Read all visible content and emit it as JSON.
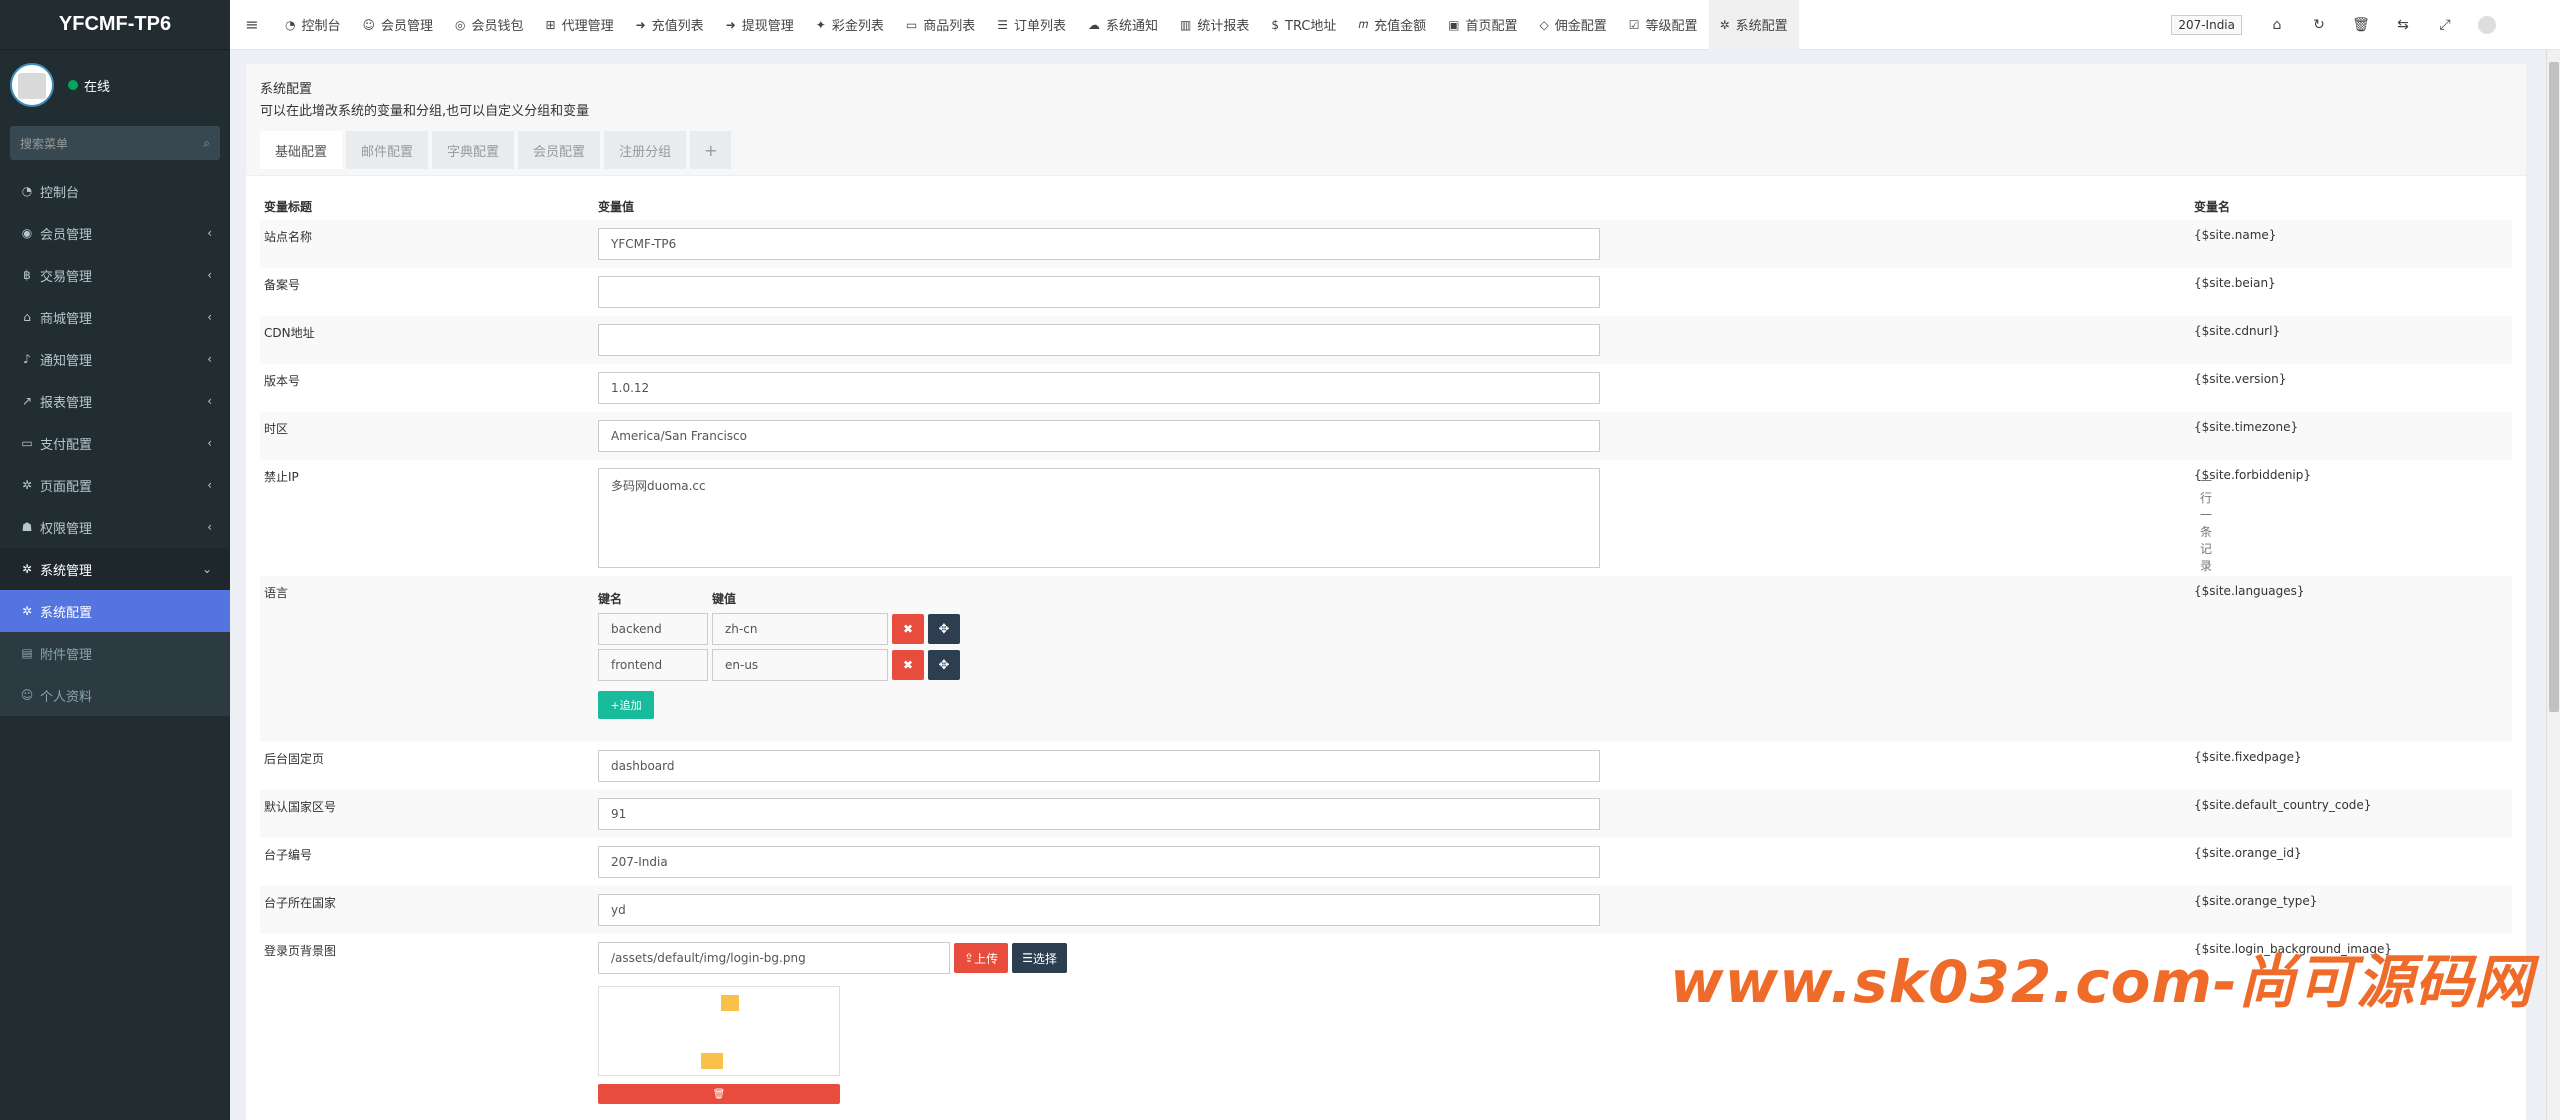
{
  "app": {
    "title": "YFCMF-TP6"
  },
  "user": {
    "status": "在线"
  },
  "search": {
    "placeholder": "搜索菜单"
  },
  "sidebar": {
    "items": [
      {
        "icon": "dashboard-icon",
        "label": "控制台"
      },
      {
        "icon": "user-icon",
        "label": "会员管理"
      },
      {
        "icon": "bitcoin-icon",
        "label": "交易管理"
      },
      {
        "icon": "home-icon",
        "label": "商城管理"
      },
      {
        "icon": "bell-icon",
        "label": "通知管理"
      },
      {
        "icon": "chart-icon",
        "label": "报表管理"
      },
      {
        "icon": "card-icon",
        "label": "支付配置"
      },
      {
        "icon": "gear-icon",
        "label": "页面配置"
      },
      {
        "icon": "users-icon",
        "label": "权限管理"
      },
      {
        "icon": "cogs-icon",
        "label": "系统管理"
      }
    ],
    "subitems": [
      {
        "icon": "gear-icon",
        "label": "系统配置"
      },
      {
        "icon": "file-icon",
        "label": "附件管理"
      },
      {
        "icon": "user-icon",
        "label": "个人资料"
      }
    ]
  },
  "topnav": {
    "tabs": [
      {
        "icon": "dashboard-icon",
        "label": "控制台"
      },
      {
        "icon": "user-icon",
        "label": "会员管理"
      },
      {
        "icon": "wallet-icon",
        "label": "会员钱包"
      },
      {
        "icon": "sitemap-icon",
        "label": "代理管理"
      },
      {
        "icon": "arrow-icon",
        "label": "充值列表"
      },
      {
        "icon": "arrow-icon",
        "label": "提现管理"
      },
      {
        "icon": "gift-icon",
        "label": "彩金列表"
      },
      {
        "icon": "desktop-icon",
        "label": "商品列表"
      },
      {
        "icon": "list-icon",
        "label": "订单列表"
      },
      {
        "icon": "comments-icon",
        "label": "系统通知"
      },
      {
        "icon": "bar-chart-icon",
        "label": "统计报表"
      },
      {
        "icon": "dollar-icon",
        "label": "TRC地址"
      },
      {
        "icon": "m-icon",
        "label": "充值金额"
      },
      {
        "icon": "square-icon",
        "label": "首页配置"
      },
      {
        "icon": "diamond-icon",
        "label": "佣金配置"
      },
      {
        "icon": "check-square-icon",
        "label": "等级配置"
      },
      {
        "icon": "gear-icon",
        "label": "系统配置"
      }
    ],
    "lang": "207-India"
  },
  "page": {
    "title": "系统配置",
    "desc": "可以在此增改系统的变量和分组,也可以自定义分组和变量",
    "tabs": [
      "基础配置",
      "邮件配置",
      "字典配置",
      "会员配置",
      "注册分组"
    ],
    "table_headers": [
      "变量标题",
      "变量值",
      "变量名"
    ],
    "rows": [
      {
        "title": "站点名称",
        "value": "YFCMF-TP6",
        "var": "{$site.name}"
      },
      {
        "title": "备案号",
        "value": "",
        "var": "{$site.beian}"
      },
      {
        "title": "CDN地址",
        "value": "",
        "var": "{$site.cdnurl}"
      },
      {
        "title": "版本号",
        "value": "1.0.12",
        "var": "{$site.version}"
      },
      {
        "title": "时区",
        "value": "America/San Francisco",
        "var": "{$site.timezone}"
      }
    ],
    "forbidden": {
      "title": "禁止IP",
      "value": "多码网duoma.cc",
      "hint": "一行一条记录",
      "var": "{$site.forbiddenip}"
    },
    "languages": {
      "title": "语言",
      "key_header": "键名",
      "val_header": "键值",
      "items": [
        {
          "key": "backend",
          "val": "zh-cn"
        },
        {
          "key": "frontend",
          "val": "en-us"
        }
      ],
      "add_label": "追加",
      "var": "{$site.languages}"
    },
    "rows2": [
      {
        "title": "后台固定页",
        "value": "dashboard",
        "var": "{$site.fixedpage}"
      },
      {
        "title": "默认国家区号",
        "value": "91",
        "var": "{$site.default_country_code}"
      },
      {
        "title": "台子编号",
        "value": "207-India",
        "var": "{$site.orange_id}"
      },
      {
        "title": "台子所在国家",
        "value": "yd",
        "var": "{$site.orange_type}"
      }
    ],
    "bg_image": {
      "title": "登录页背景图",
      "value": "/assets/default/img/login-bg.png",
      "upload_label": "上传",
      "select_label": "选择",
      "var": "{$site.login_background_image}"
    }
  },
  "watermark": "www.sk032.com-尚可源码网"
}
